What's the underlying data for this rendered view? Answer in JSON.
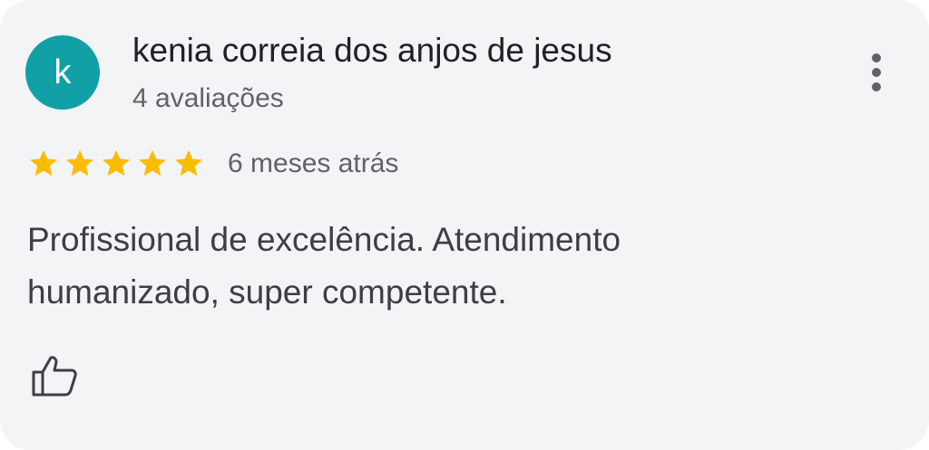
{
  "review": {
    "author_initial": "k",
    "author_name": "kenia correia dos anjos de jesus",
    "review_count": "4 avaliações",
    "rating": 5,
    "rating_max": 5,
    "time_ago": "6 meses atrás",
    "text": "Profissional de excelência. Atendimento humanizado, super competente."
  },
  "icons": {
    "menu": "more-vertical-icon",
    "star": "star-icon",
    "like": "thumbs-up-icon"
  },
  "colors": {
    "card_background": "#f3f4f6",
    "avatar_background": "#12a0a7",
    "star": "#fbbc04",
    "primary_text": "#202124",
    "secondary_text": "#5f6368"
  }
}
